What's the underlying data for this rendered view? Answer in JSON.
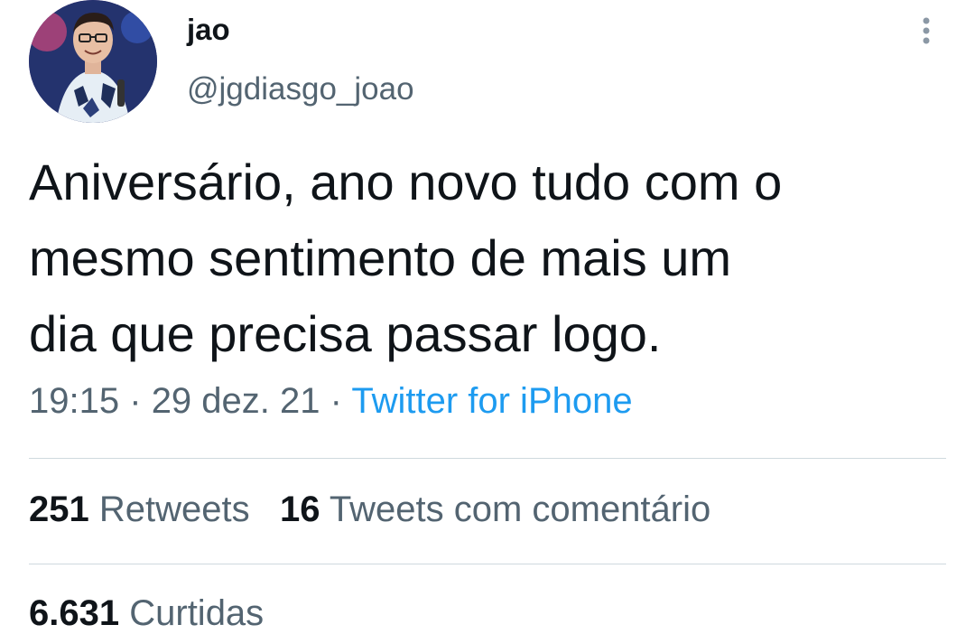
{
  "user": {
    "display_name": "jao",
    "handle": "@jgdiasgo_joao",
    "avatar_icon": "profile-photo"
  },
  "tweet": {
    "text_lines": [
      "Aniversário, ano novo tudo com o",
      "mesmo sentimento de mais um",
      "dia que precisa passar logo."
    ],
    "time": "19:15",
    "separator": "·",
    "date": "29 dez. 21",
    "source": "Twitter for iPhone"
  },
  "stats": {
    "retweets_count": "251",
    "retweets_label": "Retweets",
    "quotes_count": "16",
    "quotes_label": "Tweets com comentário",
    "likes_count": "6.631",
    "likes_label": "Curtidas"
  },
  "icons": {
    "more": "more-vertical-icon"
  },
  "colors": {
    "text": "#0f1419",
    "secondary": "#536471",
    "link": "#1d9bf0",
    "divider": "#cfd9de"
  }
}
